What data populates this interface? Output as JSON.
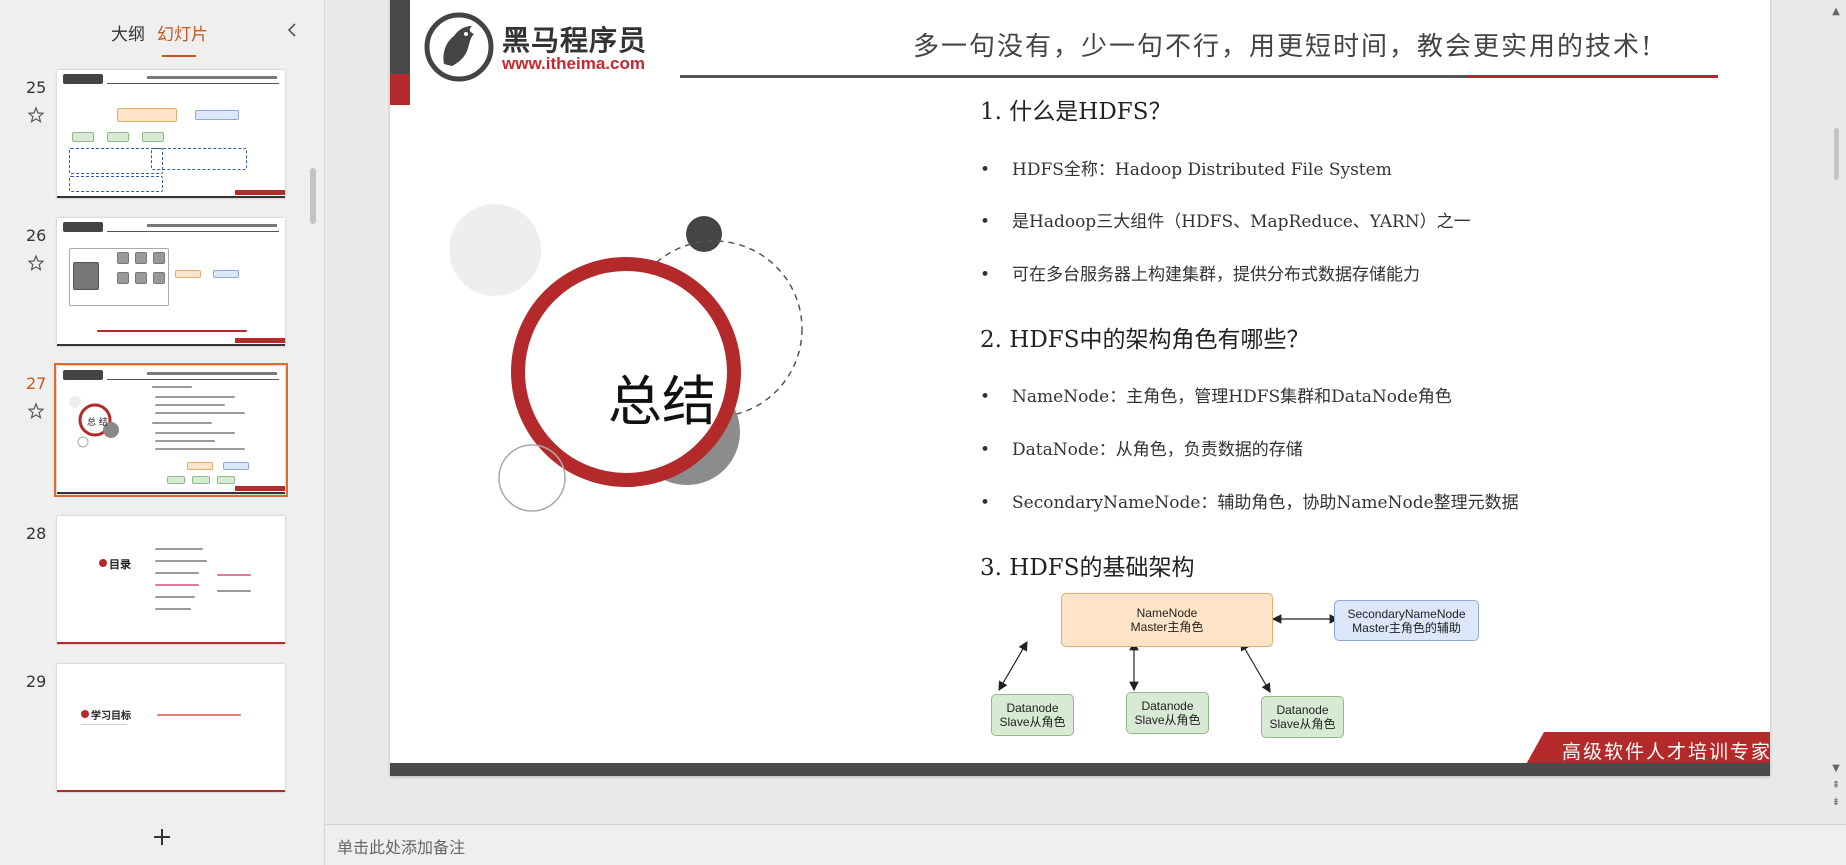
{
  "left_panel": {
    "tabs": {
      "outline": "大纲",
      "slides": "幻灯片"
    },
    "slides": [
      {
        "number": "25",
        "active": false,
        "layout": "diagram"
      },
      {
        "number": "26",
        "active": false,
        "layout": "servers"
      },
      {
        "number": "27",
        "active": true,
        "layout": "summary",
        "thumb_title": "总 结"
      },
      {
        "number": "28",
        "active": false,
        "layout": "toc",
        "thumb_title": "目录"
      },
      {
        "number": "29",
        "active": false,
        "layout": "goals",
        "thumb_title": "学习目标"
      }
    ]
  },
  "slide": {
    "logo_brand": "黑马程序员",
    "logo_url": "www.itheima.com",
    "slogan": "多一句没有，少一句不行，用更短时间，教会更实用的技术!",
    "summary_label": "总结",
    "sections": [
      {
        "title": "1.  什么是HDFS？",
        "bullets": [
          "HDFS全称：Hadoop Distributed File System",
          "是Hadoop三大组件（HDFS、MapReduce、YARN）之一",
          "可在多台服务器上构建集群，提供分布式数据存储能力"
        ]
      },
      {
        "title": "2.  HDFS中的架构角色有哪些？",
        "bullets": [
          "NameNode：主角色，管理HDFS集群和DataNode角色",
          "DataNode：从角色，负责数据的存储",
          "SecondaryNameNode：辅助角色，协助NameNode整理元数据"
        ]
      },
      {
        "title": "3.  HDFS的基础架构",
        "bullets": []
      }
    ],
    "architecture": {
      "namenode": {
        "line1": "NameNode",
        "line2": "Master主角色"
      },
      "secondary": {
        "line1": "SecondaryNameNode",
        "line2": "Master主角色的辅助"
      },
      "datanodes": [
        {
          "line1": "Datanode",
          "line2": "Slave从角色"
        },
        {
          "line1": "Datanode",
          "line2": "Slave从角色"
        },
        {
          "line1": "Datanode",
          "line2": "Slave从角色"
        }
      ]
    },
    "footer_badge": "高级软件人才培训专家",
    "colors": {
      "brand_red": "#b42a2a",
      "dark": "#4a4a4a",
      "tab_active": "#c9561b"
    }
  },
  "notes": {
    "placeholder": "单击此处添加备注"
  },
  "icons": [
    "collapse-chevron-icon",
    "star-icon",
    "plus-icon",
    "scroll-up-icon",
    "scroll-down-icon"
  ]
}
